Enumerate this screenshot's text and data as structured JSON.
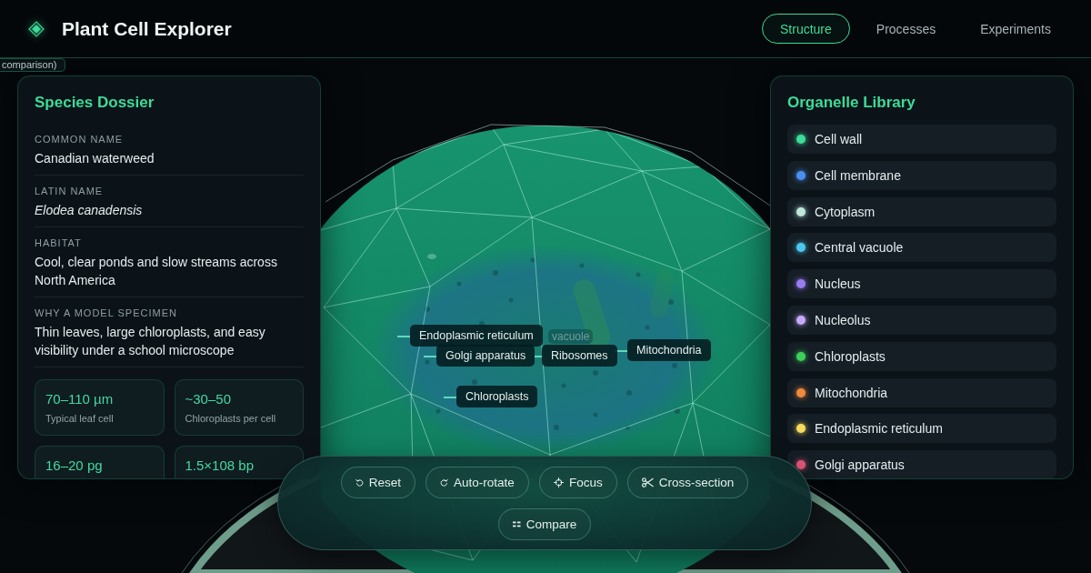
{
  "header": {
    "title": "Plant Cell Explorer",
    "tabs": [
      {
        "label": "Structure",
        "selected": true
      },
      {
        "label": "Processes",
        "selected": false
      },
      {
        "label": "Experiments",
        "selected": false
      }
    ]
  },
  "tooltip": {
    "text": "comparison)"
  },
  "species_dossier": {
    "title": "Species Dossier",
    "fields": [
      {
        "label": "COMMON NAME",
        "value": "Canadian waterweed",
        "kind": "plain"
      },
      {
        "label": "LATIN NAME",
        "value": "Elodea canadensis",
        "kind": "scientific"
      },
      {
        "label": "HABITAT",
        "value": "Cool, clear ponds and slow streams across North America",
        "kind": "plain"
      },
      {
        "label": "WHY A MODEL SPECIMEN",
        "value": "Thin leaves, large chloroplasts, and easy visibility under a school microscope",
        "kind": "plain"
      }
    ],
    "stats": [
      {
        "value": "70–110 µm",
        "caption": "Typical leaf cell"
      },
      {
        "value": "~30–50",
        "caption": "Chloroplasts per cell"
      },
      {
        "value": "16–20 pg"
      },
      {
        "value": "1.5×108 bp"
      }
    ]
  },
  "viewer": {
    "labels": [
      {
        "text": "Endoplasmic reticulum",
        "faded": false
      },
      {
        "text": "vacuole",
        "faded": true
      },
      {
        "text": "Golgi apparatus",
        "faded": false
      },
      {
        "text": "Ribosomes",
        "faded": false
      },
      {
        "text": "Mitochondria",
        "faded": false
      },
      {
        "text": "Chloroplasts",
        "faded": false
      }
    ]
  },
  "organelle_library": {
    "title": "Organelle Library",
    "items": [
      {
        "name": "Cell wall",
        "color": "#3ddc97"
      },
      {
        "name": "Cell membrane",
        "color": "#4a8ff0"
      },
      {
        "name": "Cytoplasm",
        "color": "#bfe8da"
      },
      {
        "name": "Central vacuole",
        "color": "#4cc8f0"
      },
      {
        "name": "Nucleus",
        "color": "#9a7cf2"
      },
      {
        "name": "Nucleolus",
        "color": "#c6aaf8"
      },
      {
        "name": "Chloroplasts",
        "color": "#3dcf5a"
      },
      {
        "name": "Mitochondria",
        "color": "#f08a3c"
      },
      {
        "name": "Endoplasmic reticulum",
        "color": "#f6dc5c"
      },
      {
        "name": "Golgi apparatus",
        "color": "#e8587c"
      }
    ]
  },
  "controls": {
    "buttons": [
      {
        "label": "Reset"
      },
      {
        "label": "Auto-rotate"
      },
      {
        "label": "Focus"
      },
      {
        "label": "Cross-section"
      },
      {
        "label": "Compare"
      }
    ]
  }
}
